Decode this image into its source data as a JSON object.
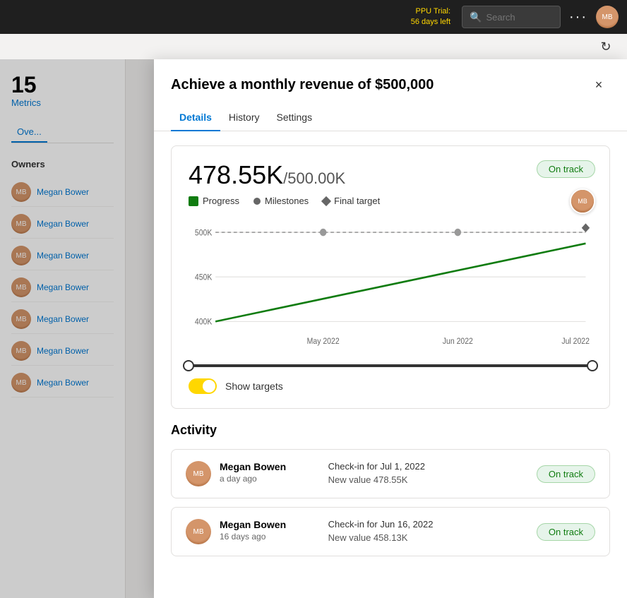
{
  "topbar": {
    "ppu_label": "PPU Trial:",
    "ppu_days": "56 days left",
    "search_placeholder": "Search",
    "dots_label": "···"
  },
  "sidebar": {
    "metrics_count": "15",
    "metrics_label": "Metrics",
    "nav_tabs": [
      {
        "id": "overview",
        "label": "Ove..."
      }
    ],
    "owners_label": "Owners",
    "owners": [
      {
        "name": "Megan Bower"
      },
      {
        "name": "Megan Bower"
      },
      {
        "name": "Megan Bower"
      },
      {
        "name": "Megan Bower"
      },
      {
        "name": "Megan Bower"
      },
      {
        "name": "Megan Bower"
      },
      {
        "name": "Megan Bower"
      }
    ]
  },
  "modal": {
    "title": "Achieve a monthly revenue of $500,000",
    "close_label": "×",
    "tabs": [
      {
        "id": "details",
        "label": "Details",
        "active": true
      },
      {
        "id": "history",
        "label": "History",
        "active": false
      },
      {
        "id": "settings",
        "label": "Settings",
        "active": false
      }
    ],
    "metric": {
      "current": "478.55K",
      "separator": "/",
      "target": "500.00K",
      "status": "On track"
    },
    "chart": {
      "legend": [
        {
          "id": "progress",
          "label": "Progress",
          "type": "square-green"
        },
        {
          "id": "milestones",
          "label": "Milestones",
          "type": "dot-gray"
        },
        {
          "id": "final_target",
          "label": "Final target",
          "type": "diamond-gray"
        }
      ],
      "y_labels": [
        "500K",
        "450K",
        "400K"
      ],
      "x_labels": [
        "May 2022",
        "Jun 2022",
        "Jul 2022"
      ],
      "show_targets_label": "Show targets"
    },
    "activity": {
      "title": "Activity",
      "items": [
        {
          "user": "Megan Bowen",
          "time": "a day ago",
          "checkin": "Check-in for Jul 1, 2022",
          "value": "New value 478.55K",
          "status": "On track"
        },
        {
          "user": "Megan Bowen",
          "time": "16 days ago",
          "checkin": "Check-in for Jun 16, 2022",
          "value": "New value 458.13K",
          "status": "On track"
        }
      ]
    }
  }
}
